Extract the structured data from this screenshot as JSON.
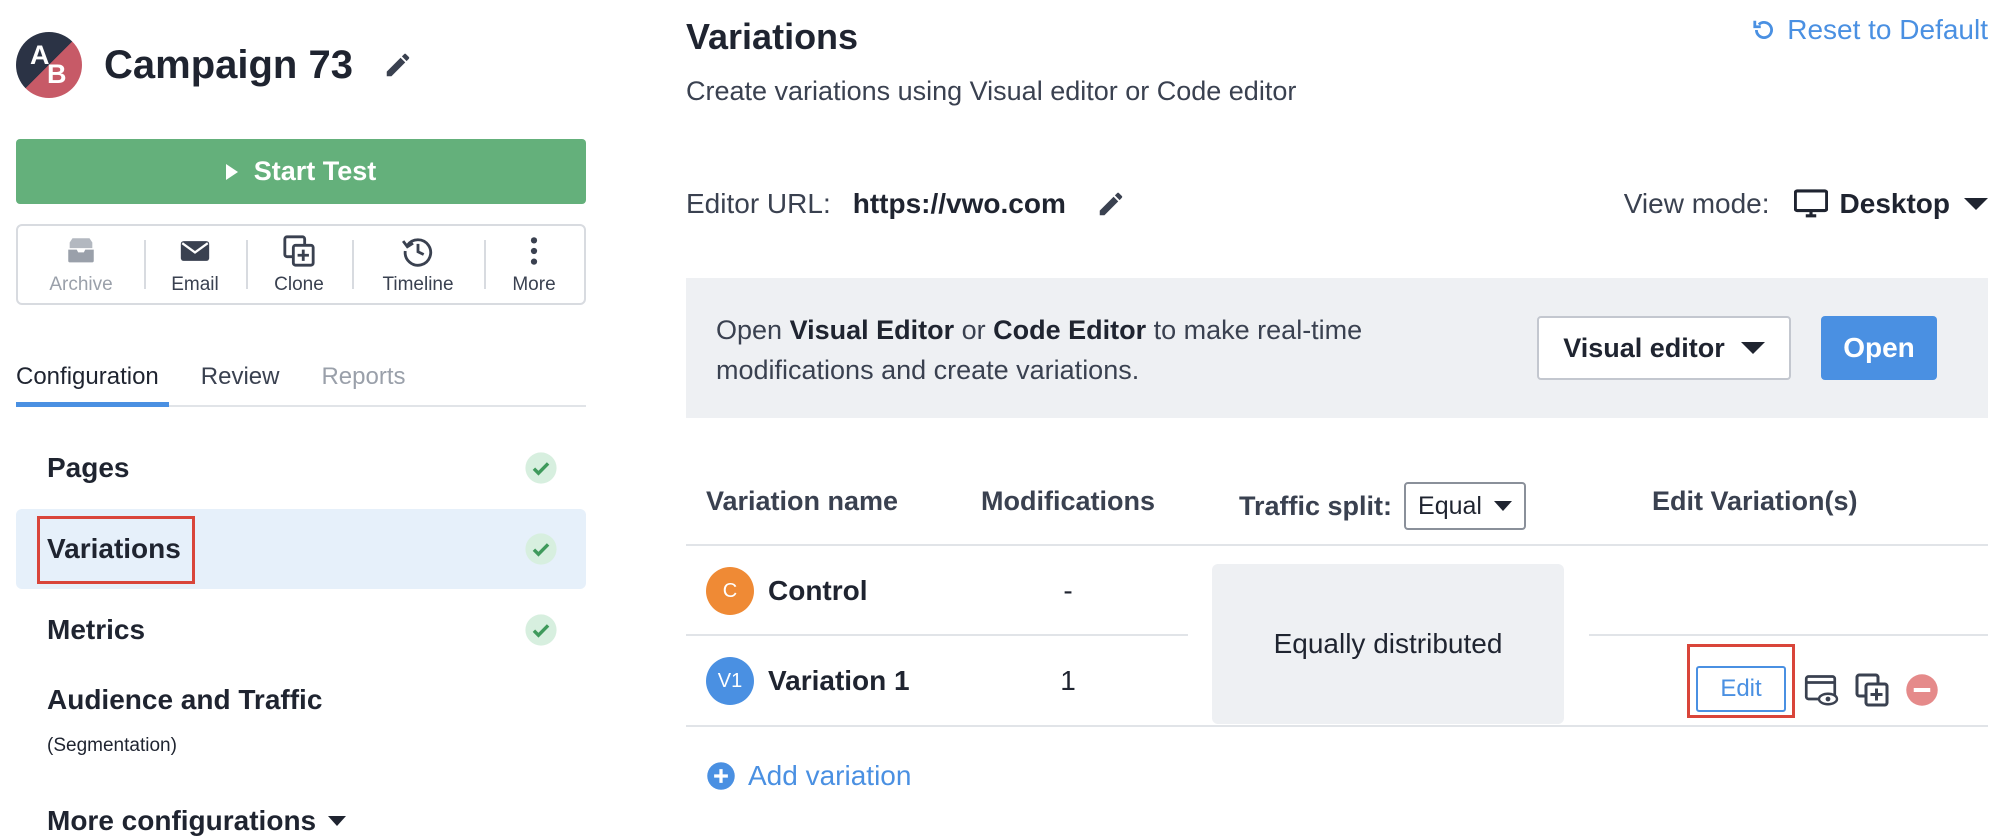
{
  "campaign": {
    "avatar_a": "A",
    "avatar_b": "B",
    "title": "Campaign 73",
    "start_label": "Start Test"
  },
  "toolbar": {
    "items": [
      {
        "label": "Archive",
        "icon": "archive-icon",
        "disabled": true
      },
      {
        "label": "Email",
        "icon": "email-icon",
        "disabled": false
      },
      {
        "label": "Clone",
        "icon": "clone-icon",
        "disabled": false
      },
      {
        "label": "Timeline",
        "icon": "timeline-icon",
        "disabled": false
      },
      {
        "label": "More",
        "icon": "more-icon",
        "disabled": false
      }
    ]
  },
  "tabs": [
    {
      "label": "Configuration",
      "state": "active"
    },
    {
      "label": "Review",
      "state": "normal"
    },
    {
      "label": "Reports",
      "state": "disabled"
    }
  ],
  "nav": {
    "items": [
      {
        "label": "Pages",
        "done": true
      },
      {
        "label": "Variations",
        "done": true,
        "selected": true
      },
      {
        "label": "Metrics",
        "done": true
      },
      {
        "label": "Audience and Traffic",
        "sublabel": "(Segmentation)"
      }
    ],
    "more_label": "More configurations"
  },
  "main": {
    "title": "Variations",
    "reset_label": "Reset to Default",
    "subtitle": "Create variations using Visual editor or Code editor",
    "editor_url_label": "Editor URL:",
    "editor_url": "https://vwo.com",
    "view_mode_label": "View mode:",
    "view_mode_value": "Desktop"
  },
  "banner": {
    "text_open": "Open ",
    "visual_editor": "Visual Editor",
    "or": " or ",
    "code_editor": "Code Editor",
    "text_rest": " to make real-time modifications and create variations.",
    "select_label": "Visual editor",
    "open_label": "Open"
  },
  "table": {
    "headers": {
      "name": "Variation name",
      "modifications": "Modifications",
      "traffic": "Traffic split:",
      "edit": "Edit Variation(s)"
    },
    "traffic_value": "Equal",
    "distribution": "Equally distributed",
    "rows": [
      {
        "badge": "C",
        "name": "Control",
        "modifications": "-"
      },
      {
        "badge": "V1",
        "name": "Variation 1",
        "modifications": "1",
        "edit_label": "Edit"
      }
    ],
    "add_label": "Add variation"
  },
  "colors": {
    "accent": "#4a90e2",
    "start_button": "#64b07b",
    "highlight": "#d9453a",
    "control_badge": "#ef8a35",
    "variation_badge": "#4a90e2"
  }
}
